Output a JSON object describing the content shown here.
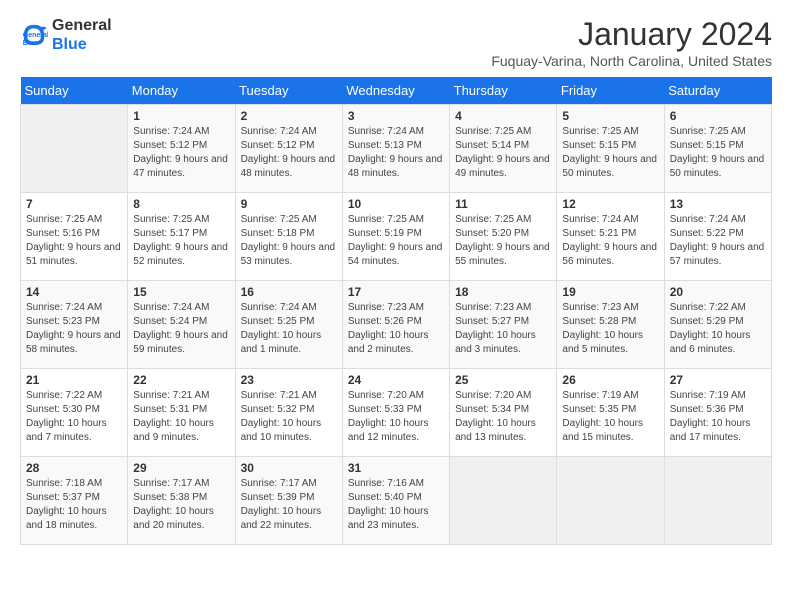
{
  "header": {
    "logo_line1": "General",
    "logo_line2": "Blue",
    "month": "January 2024",
    "location": "Fuquay-Varina, North Carolina, United States"
  },
  "weekdays": [
    "Sunday",
    "Monday",
    "Tuesday",
    "Wednesday",
    "Thursday",
    "Friday",
    "Saturday"
  ],
  "weeks": [
    [
      {
        "day": "",
        "sunrise": "",
        "sunset": "",
        "daylight": ""
      },
      {
        "day": "1",
        "sunrise": "Sunrise: 7:24 AM",
        "sunset": "Sunset: 5:12 PM",
        "daylight": "Daylight: 9 hours and 47 minutes."
      },
      {
        "day": "2",
        "sunrise": "Sunrise: 7:24 AM",
        "sunset": "Sunset: 5:12 PM",
        "daylight": "Daylight: 9 hours and 48 minutes."
      },
      {
        "day": "3",
        "sunrise": "Sunrise: 7:24 AM",
        "sunset": "Sunset: 5:13 PM",
        "daylight": "Daylight: 9 hours and 48 minutes."
      },
      {
        "day": "4",
        "sunrise": "Sunrise: 7:25 AM",
        "sunset": "Sunset: 5:14 PM",
        "daylight": "Daylight: 9 hours and 49 minutes."
      },
      {
        "day": "5",
        "sunrise": "Sunrise: 7:25 AM",
        "sunset": "Sunset: 5:15 PM",
        "daylight": "Daylight: 9 hours and 50 minutes."
      },
      {
        "day": "6",
        "sunrise": "Sunrise: 7:25 AM",
        "sunset": "Sunset: 5:15 PM",
        "daylight": "Daylight: 9 hours and 50 minutes."
      }
    ],
    [
      {
        "day": "7",
        "sunrise": "Sunrise: 7:25 AM",
        "sunset": "Sunset: 5:16 PM",
        "daylight": "Daylight: 9 hours and 51 minutes."
      },
      {
        "day": "8",
        "sunrise": "Sunrise: 7:25 AM",
        "sunset": "Sunset: 5:17 PM",
        "daylight": "Daylight: 9 hours and 52 minutes."
      },
      {
        "day": "9",
        "sunrise": "Sunrise: 7:25 AM",
        "sunset": "Sunset: 5:18 PM",
        "daylight": "Daylight: 9 hours and 53 minutes."
      },
      {
        "day": "10",
        "sunrise": "Sunrise: 7:25 AM",
        "sunset": "Sunset: 5:19 PM",
        "daylight": "Daylight: 9 hours and 54 minutes."
      },
      {
        "day": "11",
        "sunrise": "Sunrise: 7:25 AM",
        "sunset": "Sunset: 5:20 PM",
        "daylight": "Daylight: 9 hours and 55 minutes."
      },
      {
        "day": "12",
        "sunrise": "Sunrise: 7:24 AM",
        "sunset": "Sunset: 5:21 PM",
        "daylight": "Daylight: 9 hours and 56 minutes."
      },
      {
        "day": "13",
        "sunrise": "Sunrise: 7:24 AM",
        "sunset": "Sunset: 5:22 PM",
        "daylight": "Daylight: 9 hours and 57 minutes."
      }
    ],
    [
      {
        "day": "14",
        "sunrise": "Sunrise: 7:24 AM",
        "sunset": "Sunset: 5:23 PM",
        "daylight": "Daylight: 9 hours and 58 minutes."
      },
      {
        "day": "15",
        "sunrise": "Sunrise: 7:24 AM",
        "sunset": "Sunset: 5:24 PM",
        "daylight": "Daylight: 9 hours and 59 minutes."
      },
      {
        "day": "16",
        "sunrise": "Sunrise: 7:24 AM",
        "sunset": "Sunset: 5:25 PM",
        "daylight": "Daylight: 10 hours and 1 minute."
      },
      {
        "day": "17",
        "sunrise": "Sunrise: 7:23 AM",
        "sunset": "Sunset: 5:26 PM",
        "daylight": "Daylight: 10 hours and 2 minutes."
      },
      {
        "day": "18",
        "sunrise": "Sunrise: 7:23 AM",
        "sunset": "Sunset: 5:27 PM",
        "daylight": "Daylight: 10 hours and 3 minutes."
      },
      {
        "day": "19",
        "sunrise": "Sunrise: 7:23 AM",
        "sunset": "Sunset: 5:28 PM",
        "daylight": "Daylight: 10 hours and 5 minutes."
      },
      {
        "day": "20",
        "sunrise": "Sunrise: 7:22 AM",
        "sunset": "Sunset: 5:29 PM",
        "daylight": "Daylight: 10 hours and 6 minutes."
      }
    ],
    [
      {
        "day": "21",
        "sunrise": "Sunrise: 7:22 AM",
        "sunset": "Sunset: 5:30 PM",
        "daylight": "Daylight: 10 hours and 7 minutes."
      },
      {
        "day": "22",
        "sunrise": "Sunrise: 7:21 AM",
        "sunset": "Sunset: 5:31 PM",
        "daylight": "Daylight: 10 hours and 9 minutes."
      },
      {
        "day": "23",
        "sunrise": "Sunrise: 7:21 AM",
        "sunset": "Sunset: 5:32 PM",
        "daylight": "Daylight: 10 hours and 10 minutes."
      },
      {
        "day": "24",
        "sunrise": "Sunrise: 7:20 AM",
        "sunset": "Sunset: 5:33 PM",
        "daylight": "Daylight: 10 hours and 12 minutes."
      },
      {
        "day": "25",
        "sunrise": "Sunrise: 7:20 AM",
        "sunset": "Sunset: 5:34 PM",
        "daylight": "Daylight: 10 hours and 13 minutes."
      },
      {
        "day": "26",
        "sunrise": "Sunrise: 7:19 AM",
        "sunset": "Sunset: 5:35 PM",
        "daylight": "Daylight: 10 hours and 15 minutes."
      },
      {
        "day": "27",
        "sunrise": "Sunrise: 7:19 AM",
        "sunset": "Sunset: 5:36 PM",
        "daylight": "Daylight: 10 hours and 17 minutes."
      }
    ],
    [
      {
        "day": "28",
        "sunrise": "Sunrise: 7:18 AM",
        "sunset": "Sunset: 5:37 PM",
        "daylight": "Daylight: 10 hours and 18 minutes."
      },
      {
        "day": "29",
        "sunrise": "Sunrise: 7:17 AM",
        "sunset": "Sunset: 5:38 PM",
        "daylight": "Daylight: 10 hours and 20 minutes."
      },
      {
        "day": "30",
        "sunrise": "Sunrise: 7:17 AM",
        "sunset": "Sunset: 5:39 PM",
        "daylight": "Daylight: 10 hours and 22 minutes."
      },
      {
        "day": "31",
        "sunrise": "Sunrise: 7:16 AM",
        "sunset": "Sunset: 5:40 PM",
        "daylight": "Daylight: 10 hours and 23 minutes."
      },
      {
        "day": "",
        "sunrise": "",
        "sunset": "",
        "daylight": ""
      },
      {
        "day": "",
        "sunrise": "",
        "sunset": "",
        "daylight": ""
      },
      {
        "day": "",
        "sunrise": "",
        "sunset": "",
        "daylight": ""
      }
    ]
  ]
}
